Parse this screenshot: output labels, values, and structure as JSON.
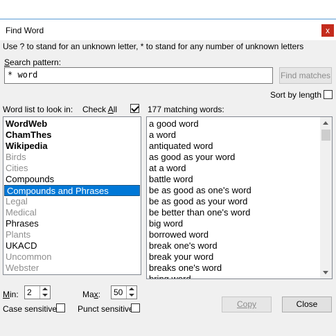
{
  "window": {
    "title": "Find Word",
    "close_glyph": "x"
  },
  "instruction": "Use ? to stand for an unknown letter, * to stand for any number of unknown letters",
  "search": {
    "label_first": "S",
    "label_rest": "earch pattern:",
    "value": "* word",
    "find_button": "Find matches"
  },
  "sort": {
    "label": "Sort by length",
    "checked": false
  },
  "wordlist": {
    "label": "Word list to look in:",
    "check_all_prefix": "Check ",
    "check_all_u": "A",
    "check_all_rest": "ll",
    "check_all_checked": true,
    "items": [
      {
        "label": "WordWeb",
        "style": "bold"
      },
      {
        "label": "ChamThes",
        "style": "bold"
      },
      {
        "label": "Wikipedia",
        "style": "bold"
      },
      {
        "label": "Birds",
        "style": "grey"
      },
      {
        "label": "Cities",
        "style": "grey"
      },
      {
        "label": "Compounds",
        "style": "normal"
      },
      {
        "label": "Compounds and Phrases",
        "style": "selected"
      },
      {
        "label": "Legal",
        "style": "grey"
      },
      {
        "label": "Medical",
        "style": "grey"
      },
      {
        "label": "Phrases",
        "style": "normal"
      },
      {
        "label": "Plants",
        "style": "grey"
      },
      {
        "label": "UKACD",
        "style": "normal"
      },
      {
        "label": "Uncommon",
        "style": "grey"
      },
      {
        "label": "Webster",
        "style": "grey"
      }
    ]
  },
  "matches": {
    "label": "177 matching words:",
    "items": [
      "a good word",
      "a word",
      "antiquated word",
      "as good as your word",
      "at a word",
      "battle word",
      "be as good as one's word",
      "be as good as your word",
      "be better than one's word",
      "big word",
      "borrowed word",
      "break one's word",
      "break your word",
      "breaks one's word",
      "bring word"
    ]
  },
  "min": {
    "label_u": "M",
    "label_rest": "in:",
    "value": "2"
  },
  "max": {
    "label_pre": "Ma",
    "label_u": "x",
    "label_rest": ":",
    "value": "50"
  },
  "case_sensitive": {
    "label": "Case sensitive",
    "checked": false
  },
  "punct_sensitive": {
    "label": "Punct sensitive",
    "checked": false
  },
  "buttons": {
    "copy": "Copy",
    "close": "Close"
  }
}
